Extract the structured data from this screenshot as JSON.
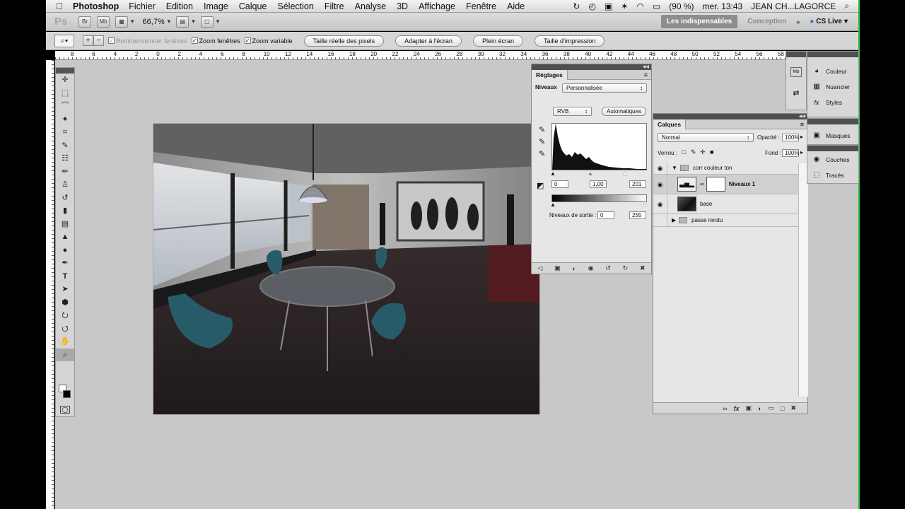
{
  "menubar": {
    "app_name": "Photoshop",
    "items": [
      "Fichier",
      "Edition",
      "Image",
      "Calque",
      "Sélection",
      "Filtre",
      "Analyse",
      "3D",
      "Affichage",
      "Fenêtre",
      "Aide"
    ],
    "battery": "(90 %)",
    "clock": "mer. 13:43",
    "user": "JEAN CH...LAGORCE"
  },
  "appbar": {
    "logo": "Ps",
    "bridge_label": "Br",
    "minibridge_label": "Mb",
    "zoom": "66,7%",
    "workspace_active": "Les indispensables",
    "workspace_other": "Conception",
    "cs_live": "CS Live"
  },
  "options": {
    "resize_windows": "Redimensionner fenêtres",
    "zoom_all": "Zoom fenêtres",
    "scrubby_zoom": "Zoom variable",
    "btn_actual_pixels": "Taille réelle des pixels",
    "btn_fit_screen": "Adapter à l'écran",
    "btn_fill_screen": "Plein écran",
    "btn_print_size": "Taille d'impression"
  },
  "ruler": {
    "labels": [
      "8",
      "6",
      "4",
      "2",
      "0",
      "2",
      "4",
      "6",
      "8",
      "10",
      "12",
      "14",
      "16",
      "18",
      "20",
      "22",
      "24",
      "26",
      "28",
      "30",
      "32",
      "34",
      "36",
      "38",
      "40",
      "42",
      "44",
      "46",
      "48",
      "50",
      "52",
      "54",
      "56",
      "58"
    ]
  },
  "adjustments": {
    "tab": "Réglages",
    "preset_label": "Niveaux",
    "preset_value": "Personnalisée",
    "channel": "RVB",
    "auto_btn": "Automatiques",
    "input_black": "0",
    "input_gamma": "1,00",
    "input_white": "201",
    "output_label": "Niveaux de sortie :",
    "output_black": "0",
    "output_white": "255"
  },
  "layers": {
    "tab": "Calques",
    "blend_mode": "Normal",
    "opacity_label": "Opacité :",
    "opacity_value": "100%",
    "lock_label": "Verrou :",
    "fill_label": "Fond :",
    "fill_value": "100%",
    "items": [
      {
        "name": "corr couleur ton",
        "kind": "group"
      },
      {
        "name": "Niveaux 1",
        "kind": "adjustment"
      },
      {
        "name": "base",
        "kind": "pixel"
      },
      {
        "name": "passe rendu",
        "kind": "group"
      }
    ]
  },
  "dock_top": {
    "items": [
      "Couleur",
      "Nuancier",
      "Styles"
    ]
  },
  "dock_mid": {
    "items": [
      "Masques"
    ]
  },
  "dock_bottom": {
    "items": [
      "Couches",
      "Tracés"
    ]
  },
  "dock_mini": {
    "items": [
      "Mb"
    ]
  }
}
